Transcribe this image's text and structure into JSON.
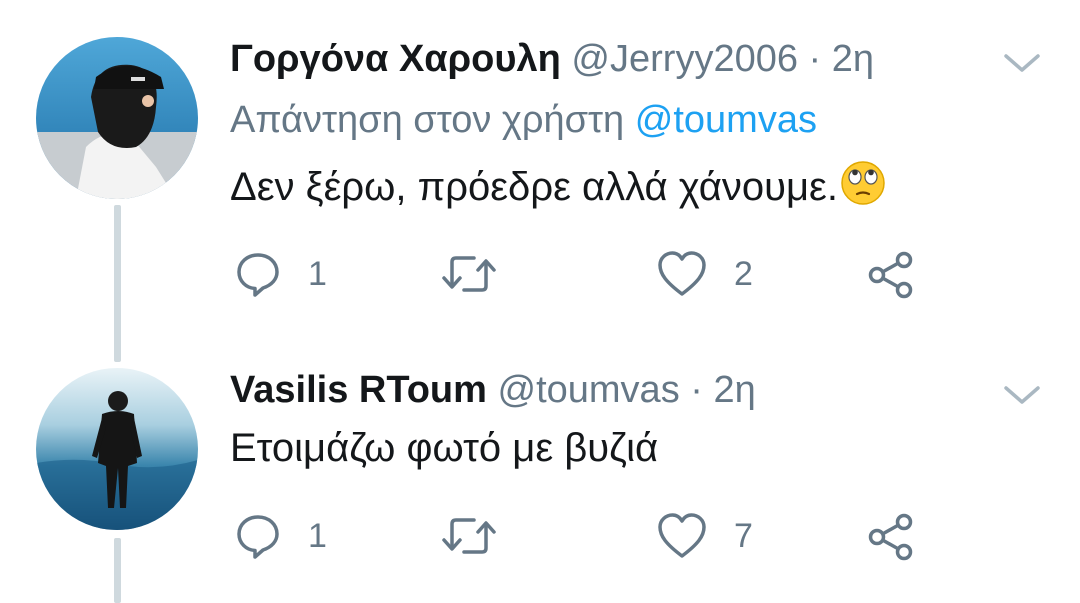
{
  "tweets": [
    {
      "display_name": "Γοργόνα Χαρουλη",
      "handle": "@Jerryy2006",
      "separator": "·",
      "time": "2η",
      "reply_prefix": "Απάντηση στον χρήστη",
      "reply_to": "@toumvas",
      "text": "Δεν ξέρω, πρόεδρε αλλά χάνουμε.",
      "emoji": "🙄",
      "reply_count": "1",
      "retweet_count": "",
      "like_count": "2"
    },
    {
      "display_name": "Vasilis RToum",
      "handle": "@toumvas",
      "separator": "·",
      "time": "2η",
      "text": "Ετοιμάζω φωτό με βυζιά",
      "reply_count": "1",
      "retweet_count": "",
      "like_count": "7"
    }
  ],
  "icons": {
    "reply": "reply-icon",
    "retweet": "retweet-icon",
    "like": "heart-icon",
    "share": "share-icon",
    "menu": "chevron-down-icon"
  },
  "colors": {
    "text": "#14171a",
    "secondary": "#657786",
    "link": "#1da1f2",
    "thread_line": "#cfd9de"
  }
}
